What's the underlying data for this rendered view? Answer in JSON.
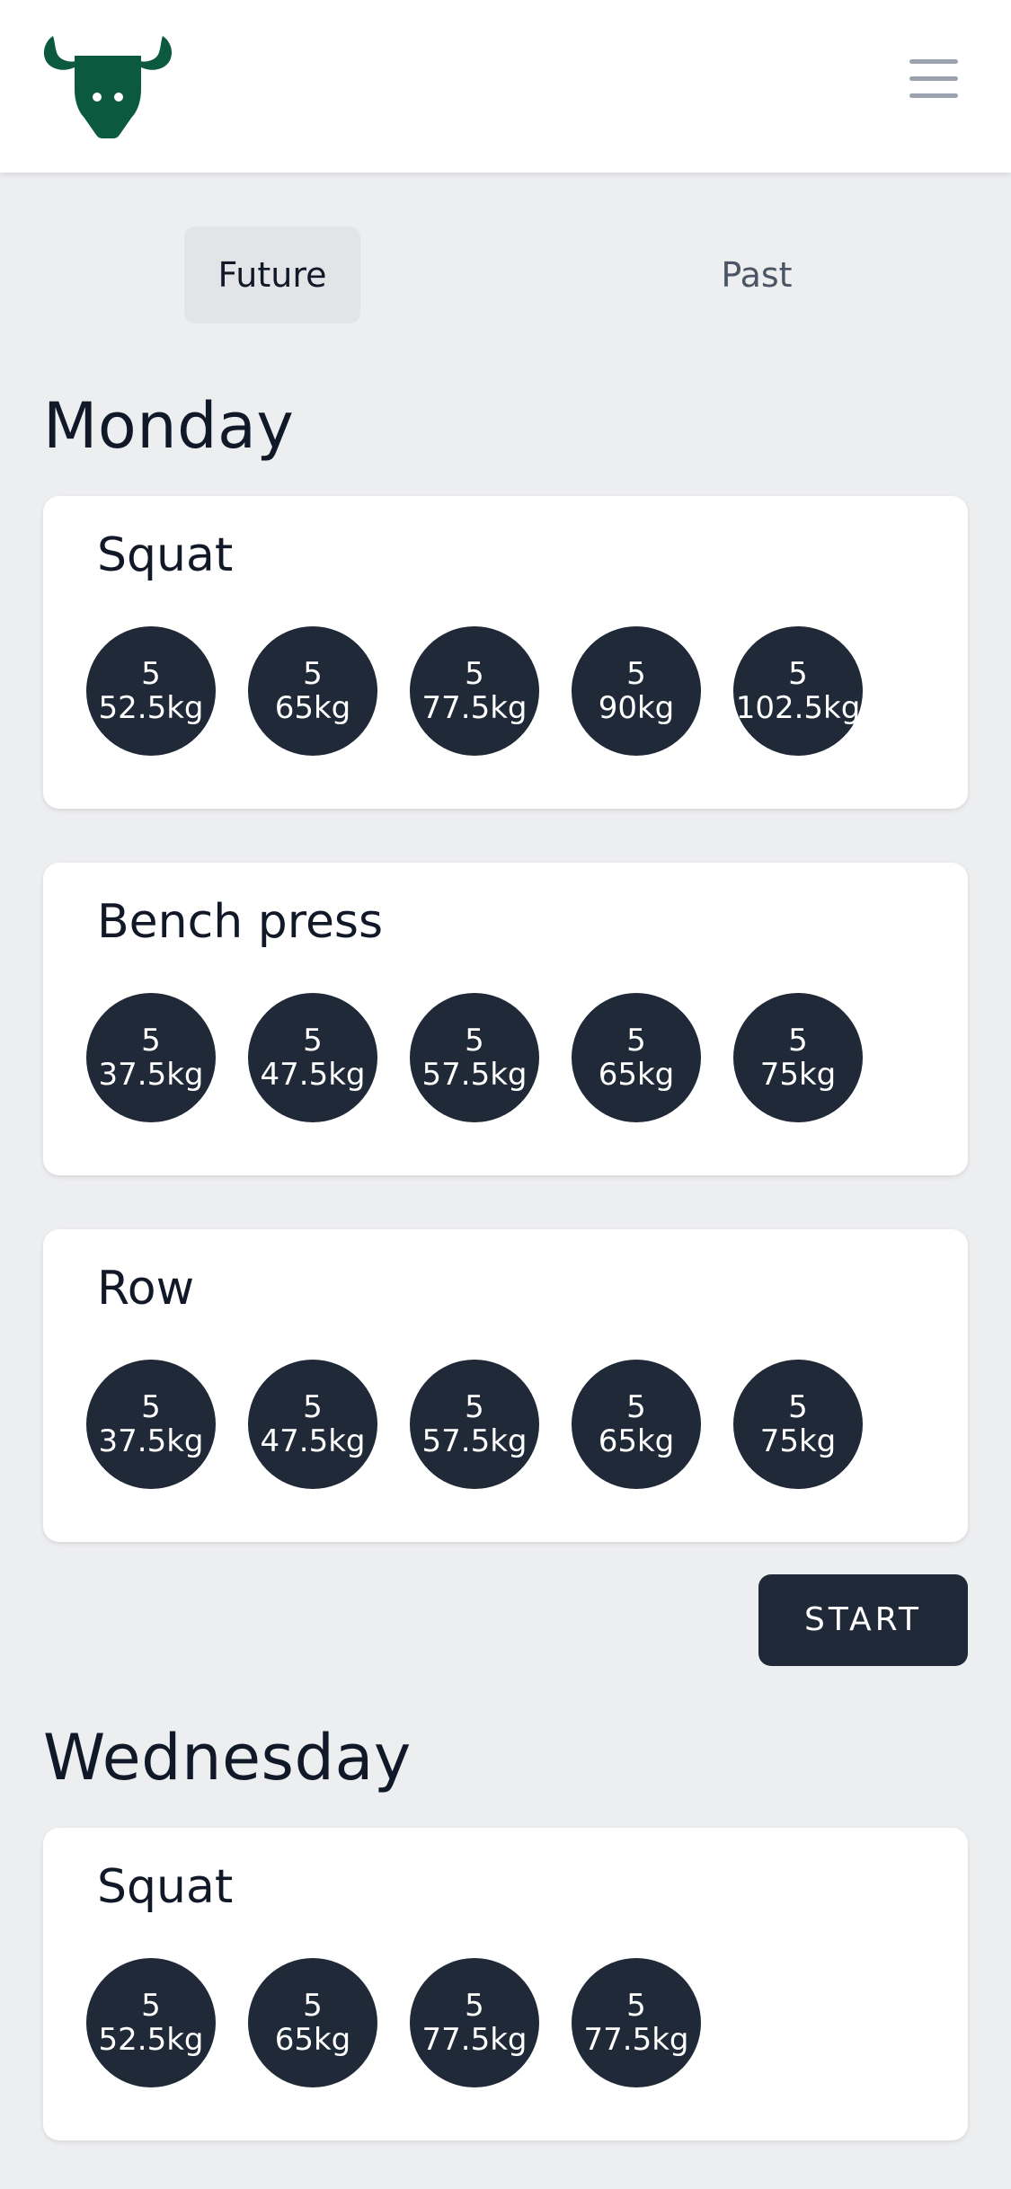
{
  "header": {
    "logo_icon": "bull-head-icon",
    "menu_icon": "hamburger-menu-icon",
    "brand_color": "#0b5a3f"
  },
  "tabs": [
    {
      "label": "Future",
      "active": true
    },
    {
      "label": "Past",
      "active": false
    }
  ],
  "days": [
    {
      "name": "Monday",
      "exercises": [
        {
          "name": "Squat",
          "sets": [
            {
              "reps": "5",
              "weight": "52.5kg"
            },
            {
              "reps": "5",
              "weight": "65kg"
            },
            {
              "reps": "5",
              "weight": "77.5kg"
            },
            {
              "reps": "5",
              "weight": "90kg"
            },
            {
              "reps": "5",
              "weight": "102.5kg"
            }
          ]
        },
        {
          "name": "Bench press",
          "sets": [
            {
              "reps": "5",
              "weight": "37.5kg"
            },
            {
              "reps": "5",
              "weight": "47.5kg"
            },
            {
              "reps": "5",
              "weight": "57.5kg"
            },
            {
              "reps": "5",
              "weight": "65kg"
            },
            {
              "reps": "5",
              "weight": "75kg"
            }
          ]
        },
        {
          "name": "Row",
          "sets": [
            {
              "reps": "5",
              "weight": "37.5kg"
            },
            {
              "reps": "5",
              "weight": "47.5kg"
            },
            {
              "reps": "5",
              "weight": "57.5kg"
            },
            {
              "reps": "5",
              "weight": "65kg"
            },
            {
              "reps": "5",
              "weight": "75kg"
            }
          ]
        }
      ],
      "start_label": "START"
    },
    {
      "name": "Wednesday",
      "exercises": [
        {
          "name": "Squat",
          "sets": [
            {
              "reps": "5",
              "weight": "52.5kg"
            },
            {
              "reps": "5",
              "weight": "65kg"
            },
            {
              "reps": "5",
              "weight": "77.5kg"
            },
            {
              "reps": "5",
              "weight": "77.5kg"
            }
          ]
        }
      ]
    }
  ]
}
